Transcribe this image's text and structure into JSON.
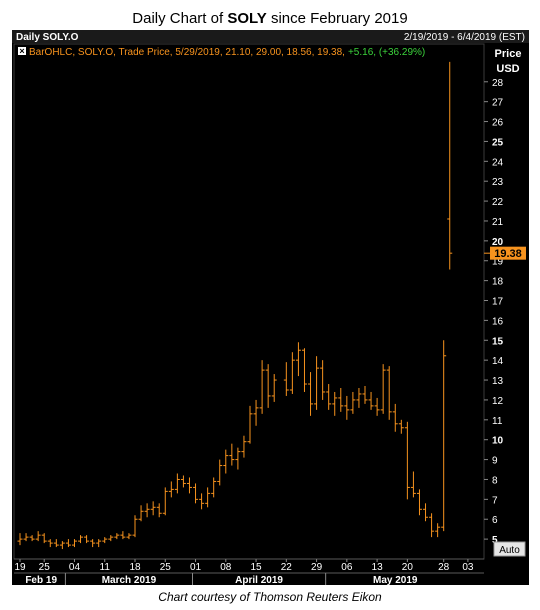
{
  "header": {
    "title_prefix": "Daily Chart of ",
    "title_ticker": "SOLY",
    "title_suffix": " since February 2019"
  },
  "panel": {
    "name": "Daily SOLY.O",
    "date_range": "2/19/2019 - 6/4/2019 (EST)",
    "axis_title_1": "Price",
    "axis_title_2": "USD",
    "legend_text": "BarOHLC, SOLY.O, Trade Price, 5/29/2019, 21.10, 29.00, 18.56, 19.38,",
    "legend_change": "+5.16, (+36.29%)",
    "last_price_label": "19.38",
    "auto_button": "Auto"
  },
  "footer": {
    "credit": "Chart courtesy of Thomson Reuters Eikon"
  },
  "colors": {
    "background": "#000000",
    "bars": "#f7931e",
    "grid": "#2a2a2a",
    "axis_text": "#ffffff",
    "legend_change": "#3bd23b",
    "last_price_bg": "#f7931e"
  },
  "chart_data": {
    "type": "ohlc",
    "title": "Daily Chart of SOLY since February 2019",
    "ylabel": "Price USD",
    "ylim": [
      4,
      29.9
    ],
    "y_ticks": [
      5,
      6,
      7,
      8,
      9,
      10,
      11,
      12,
      13,
      14,
      15,
      16,
      17,
      18,
      19,
      20,
      21,
      22,
      23,
      24,
      25,
      26,
      27,
      28
    ],
    "x_tick_labels": [
      "19",
      "25",
      "04",
      "11",
      "18",
      "25",
      "01",
      "08",
      "15",
      "22",
      "29",
      "06",
      "13",
      "20",
      "28",
      "03"
    ],
    "month_labels": [
      "Feb 19",
      "March 2019",
      "April 2019",
      "May 2019"
    ],
    "grid": false,
    "series": [
      {
        "name": "SOLY.O",
        "bars": [
          {
            "date": "2019-02-19",
            "open": 4.9,
            "high": 5.3,
            "low": 4.7,
            "close": 5.0
          },
          {
            "date": "2019-02-20",
            "open": 5.0,
            "high": 5.3,
            "low": 4.9,
            "close": 5.1
          },
          {
            "date": "2019-02-21",
            "open": 5.1,
            "high": 5.2,
            "low": 4.9,
            "close": 5.0
          },
          {
            "date": "2019-02-22",
            "open": 5.0,
            "high": 5.4,
            "low": 4.9,
            "close": 5.2
          },
          {
            "date": "2019-02-25",
            "open": 5.2,
            "high": 5.3,
            "low": 4.8,
            "close": 4.9
          },
          {
            "date": "2019-02-26",
            "open": 4.9,
            "high": 5.0,
            "low": 4.6,
            "close": 4.8
          },
          {
            "date": "2019-02-27",
            "open": 4.8,
            "high": 5.0,
            "low": 4.6,
            "close": 4.7
          },
          {
            "date": "2019-02-28",
            "open": 4.7,
            "high": 4.9,
            "low": 4.5,
            "close": 4.8
          },
          {
            "date": "2019-03-01",
            "open": 4.8,
            "high": 5.0,
            "low": 4.6,
            "close": 4.7
          },
          {
            "date": "2019-03-04",
            "open": 4.7,
            "high": 5.0,
            "low": 4.6,
            "close": 4.9
          },
          {
            "date": "2019-03-05",
            "open": 4.9,
            "high": 5.2,
            "low": 4.8,
            "close": 5.1
          },
          {
            "date": "2019-03-06",
            "open": 5.1,
            "high": 5.2,
            "low": 4.8,
            "close": 4.9
          },
          {
            "date": "2019-03-07",
            "open": 4.9,
            "high": 5.0,
            "low": 4.6,
            "close": 4.8
          },
          {
            "date": "2019-03-08",
            "open": 4.8,
            "high": 5.0,
            "low": 4.6,
            "close": 4.9
          },
          {
            "date": "2019-03-11",
            "open": 4.9,
            "high": 5.1,
            "low": 4.8,
            "close": 5.0
          },
          {
            "date": "2019-03-12",
            "open": 5.0,
            "high": 5.2,
            "low": 4.9,
            "close": 5.1
          },
          {
            "date": "2019-03-13",
            "open": 5.1,
            "high": 5.3,
            "low": 5.0,
            "close": 5.2
          },
          {
            "date": "2019-03-14",
            "open": 5.2,
            "high": 5.4,
            "low": 5.0,
            "close": 5.1
          },
          {
            "date": "2019-03-15",
            "open": 5.1,
            "high": 5.3,
            "low": 5.0,
            "close": 5.2
          },
          {
            "date": "2019-03-18",
            "open": 5.2,
            "high": 6.2,
            "low": 5.1,
            "close": 6.0
          },
          {
            "date": "2019-03-19",
            "open": 6.0,
            "high": 6.7,
            "low": 5.9,
            "close": 6.4
          },
          {
            "date": "2019-03-20",
            "open": 6.4,
            "high": 6.8,
            "low": 6.1,
            "close": 6.5
          },
          {
            "date": "2019-03-21",
            "open": 6.5,
            "high": 6.9,
            "low": 6.2,
            "close": 6.6
          },
          {
            "date": "2019-03-22",
            "open": 6.6,
            "high": 6.8,
            "low": 6.1,
            "close": 6.3
          },
          {
            "date": "2019-03-25",
            "open": 6.3,
            "high": 7.6,
            "low": 6.2,
            "close": 7.4
          },
          {
            "date": "2019-03-26",
            "open": 7.4,
            "high": 7.9,
            "low": 7.1,
            "close": 7.5
          },
          {
            "date": "2019-03-27",
            "open": 7.5,
            "high": 8.3,
            "low": 7.3,
            "close": 8.0
          },
          {
            "date": "2019-03-28",
            "open": 8.0,
            "high": 8.2,
            "low": 7.6,
            "close": 7.8
          },
          {
            "date": "2019-03-29",
            "open": 7.8,
            "high": 8.1,
            "low": 7.3,
            "close": 7.6
          },
          {
            "date": "2019-04-01",
            "open": 7.6,
            "high": 7.8,
            "low": 6.8,
            "close": 7.0
          },
          {
            "date": "2019-04-02",
            "open": 7.0,
            "high": 7.3,
            "low": 6.5,
            "close": 6.8
          },
          {
            "date": "2019-04-03",
            "open": 6.8,
            "high": 7.6,
            "low": 6.6,
            "close": 7.3
          },
          {
            "date": "2019-04-04",
            "open": 7.3,
            "high": 8.1,
            "low": 7.1,
            "close": 7.9
          },
          {
            "date": "2019-04-05",
            "open": 7.9,
            "high": 9.0,
            "low": 7.7,
            "close": 8.7
          },
          {
            "date": "2019-04-08",
            "open": 8.7,
            "high": 9.5,
            "low": 8.3,
            "close": 9.2
          },
          {
            "date": "2019-04-09",
            "open": 9.2,
            "high": 9.8,
            "low": 8.7,
            "close": 9.0
          },
          {
            "date": "2019-04-10",
            "open": 9.0,
            "high": 9.6,
            "low": 8.5,
            "close": 9.4
          },
          {
            "date": "2019-04-11",
            "open": 9.4,
            "high": 10.2,
            "low": 9.1,
            "close": 9.9
          },
          {
            "date": "2019-04-12",
            "open": 9.9,
            "high": 11.7,
            "low": 9.8,
            "close": 11.3
          },
          {
            "date": "2019-04-15",
            "open": 11.3,
            "high": 12.0,
            "low": 10.7,
            "close": 11.6
          },
          {
            "date": "2019-04-16",
            "open": 11.6,
            "high": 14.0,
            "low": 11.3,
            "close": 13.5
          },
          {
            "date": "2019-04-17",
            "open": 13.5,
            "high": 13.8,
            "low": 11.6,
            "close": 12.2
          },
          {
            "date": "2019-04-18",
            "open": 12.2,
            "high": 13.3,
            "low": 11.9,
            "close": 13.0
          },
          {
            "date": "2019-04-22",
            "open": 13.0,
            "high": 13.9,
            "low": 12.2,
            "close": 12.5
          },
          {
            "date": "2019-04-23",
            "open": 12.5,
            "high": 14.4,
            "low": 12.3,
            "close": 14.0
          },
          {
            "date": "2019-04-24",
            "open": 14.0,
            "high": 14.9,
            "low": 13.2,
            "close": 14.5
          },
          {
            "date": "2019-04-25",
            "open": 14.5,
            "high": 14.6,
            "low": 12.4,
            "close": 12.8
          },
          {
            "date": "2019-04-26",
            "open": 12.8,
            "high": 13.4,
            "low": 11.2,
            "close": 11.8
          },
          {
            "date": "2019-04-29",
            "open": 11.8,
            "high": 14.2,
            "low": 11.5,
            "close": 13.6
          },
          {
            "date": "2019-04-30",
            "open": 13.6,
            "high": 14.0,
            "low": 12.0,
            "close": 12.4
          },
          {
            "date": "2019-05-01",
            "open": 12.4,
            "high": 12.8,
            "low": 11.5,
            "close": 11.8
          },
          {
            "date": "2019-05-02",
            "open": 11.8,
            "high": 12.4,
            "low": 11.2,
            "close": 12.1
          },
          {
            "date": "2019-05-03",
            "open": 12.1,
            "high": 12.6,
            "low": 11.4,
            "close": 11.7
          },
          {
            "date": "2019-05-06",
            "open": 11.7,
            "high": 12.2,
            "low": 11.0,
            "close": 11.5
          },
          {
            "date": "2019-05-07",
            "open": 11.5,
            "high": 12.4,
            "low": 11.3,
            "close": 12.0
          },
          {
            "date": "2019-05-08",
            "open": 12.0,
            "high": 12.6,
            "low": 11.6,
            "close": 12.3
          },
          {
            "date": "2019-05-09",
            "open": 12.3,
            "high": 12.7,
            "low": 11.8,
            "close": 12.0
          },
          {
            "date": "2019-05-10",
            "open": 12.0,
            "high": 12.4,
            "low": 11.5,
            "close": 11.7
          },
          {
            "date": "2019-05-13",
            "open": 11.7,
            "high": 12.1,
            "low": 11.2,
            "close": 11.5
          },
          {
            "date": "2019-05-14",
            "open": 11.5,
            "high": 13.8,
            "low": 11.3,
            "close": 13.5
          },
          {
            "date": "2019-05-15",
            "open": 13.5,
            "high": 13.7,
            "low": 11.0,
            "close": 11.4
          },
          {
            "date": "2019-05-16",
            "open": 11.4,
            "high": 11.8,
            "low": 10.4,
            "close": 10.8
          },
          {
            "date": "2019-05-17",
            "open": 10.8,
            "high": 11.0,
            "low": 10.3,
            "close": 10.6
          },
          {
            "date": "2019-05-20",
            "open": 10.6,
            "high": 10.9,
            "low": 7.0,
            "close": 7.6
          },
          {
            "date": "2019-05-21",
            "open": 7.6,
            "high": 8.4,
            "low": 7.1,
            "close": 7.3
          },
          {
            "date": "2019-05-22",
            "open": 7.3,
            "high": 7.5,
            "low": 6.2,
            "close": 6.5
          },
          {
            "date": "2019-05-23",
            "open": 6.5,
            "high": 6.8,
            "low": 5.9,
            "close": 6.1
          },
          {
            "date": "2019-05-24",
            "open": 6.1,
            "high": 6.3,
            "low": 5.1,
            "close": 5.4
          },
          {
            "date": "2019-05-27",
            "open": 5.4,
            "high": 5.8,
            "low": 5.1,
            "close": 5.6
          },
          {
            "date": "2019-05-28",
            "open": 5.6,
            "high": 15.0,
            "low": 5.4,
            "close": 14.22
          },
          {
            "date": "2019-05-29",
            "open": 21.1,
            "high": 29.0,
            "low": 18.56,
            "close": 19.38
          }
        ]
      }
    ]
  }
}
